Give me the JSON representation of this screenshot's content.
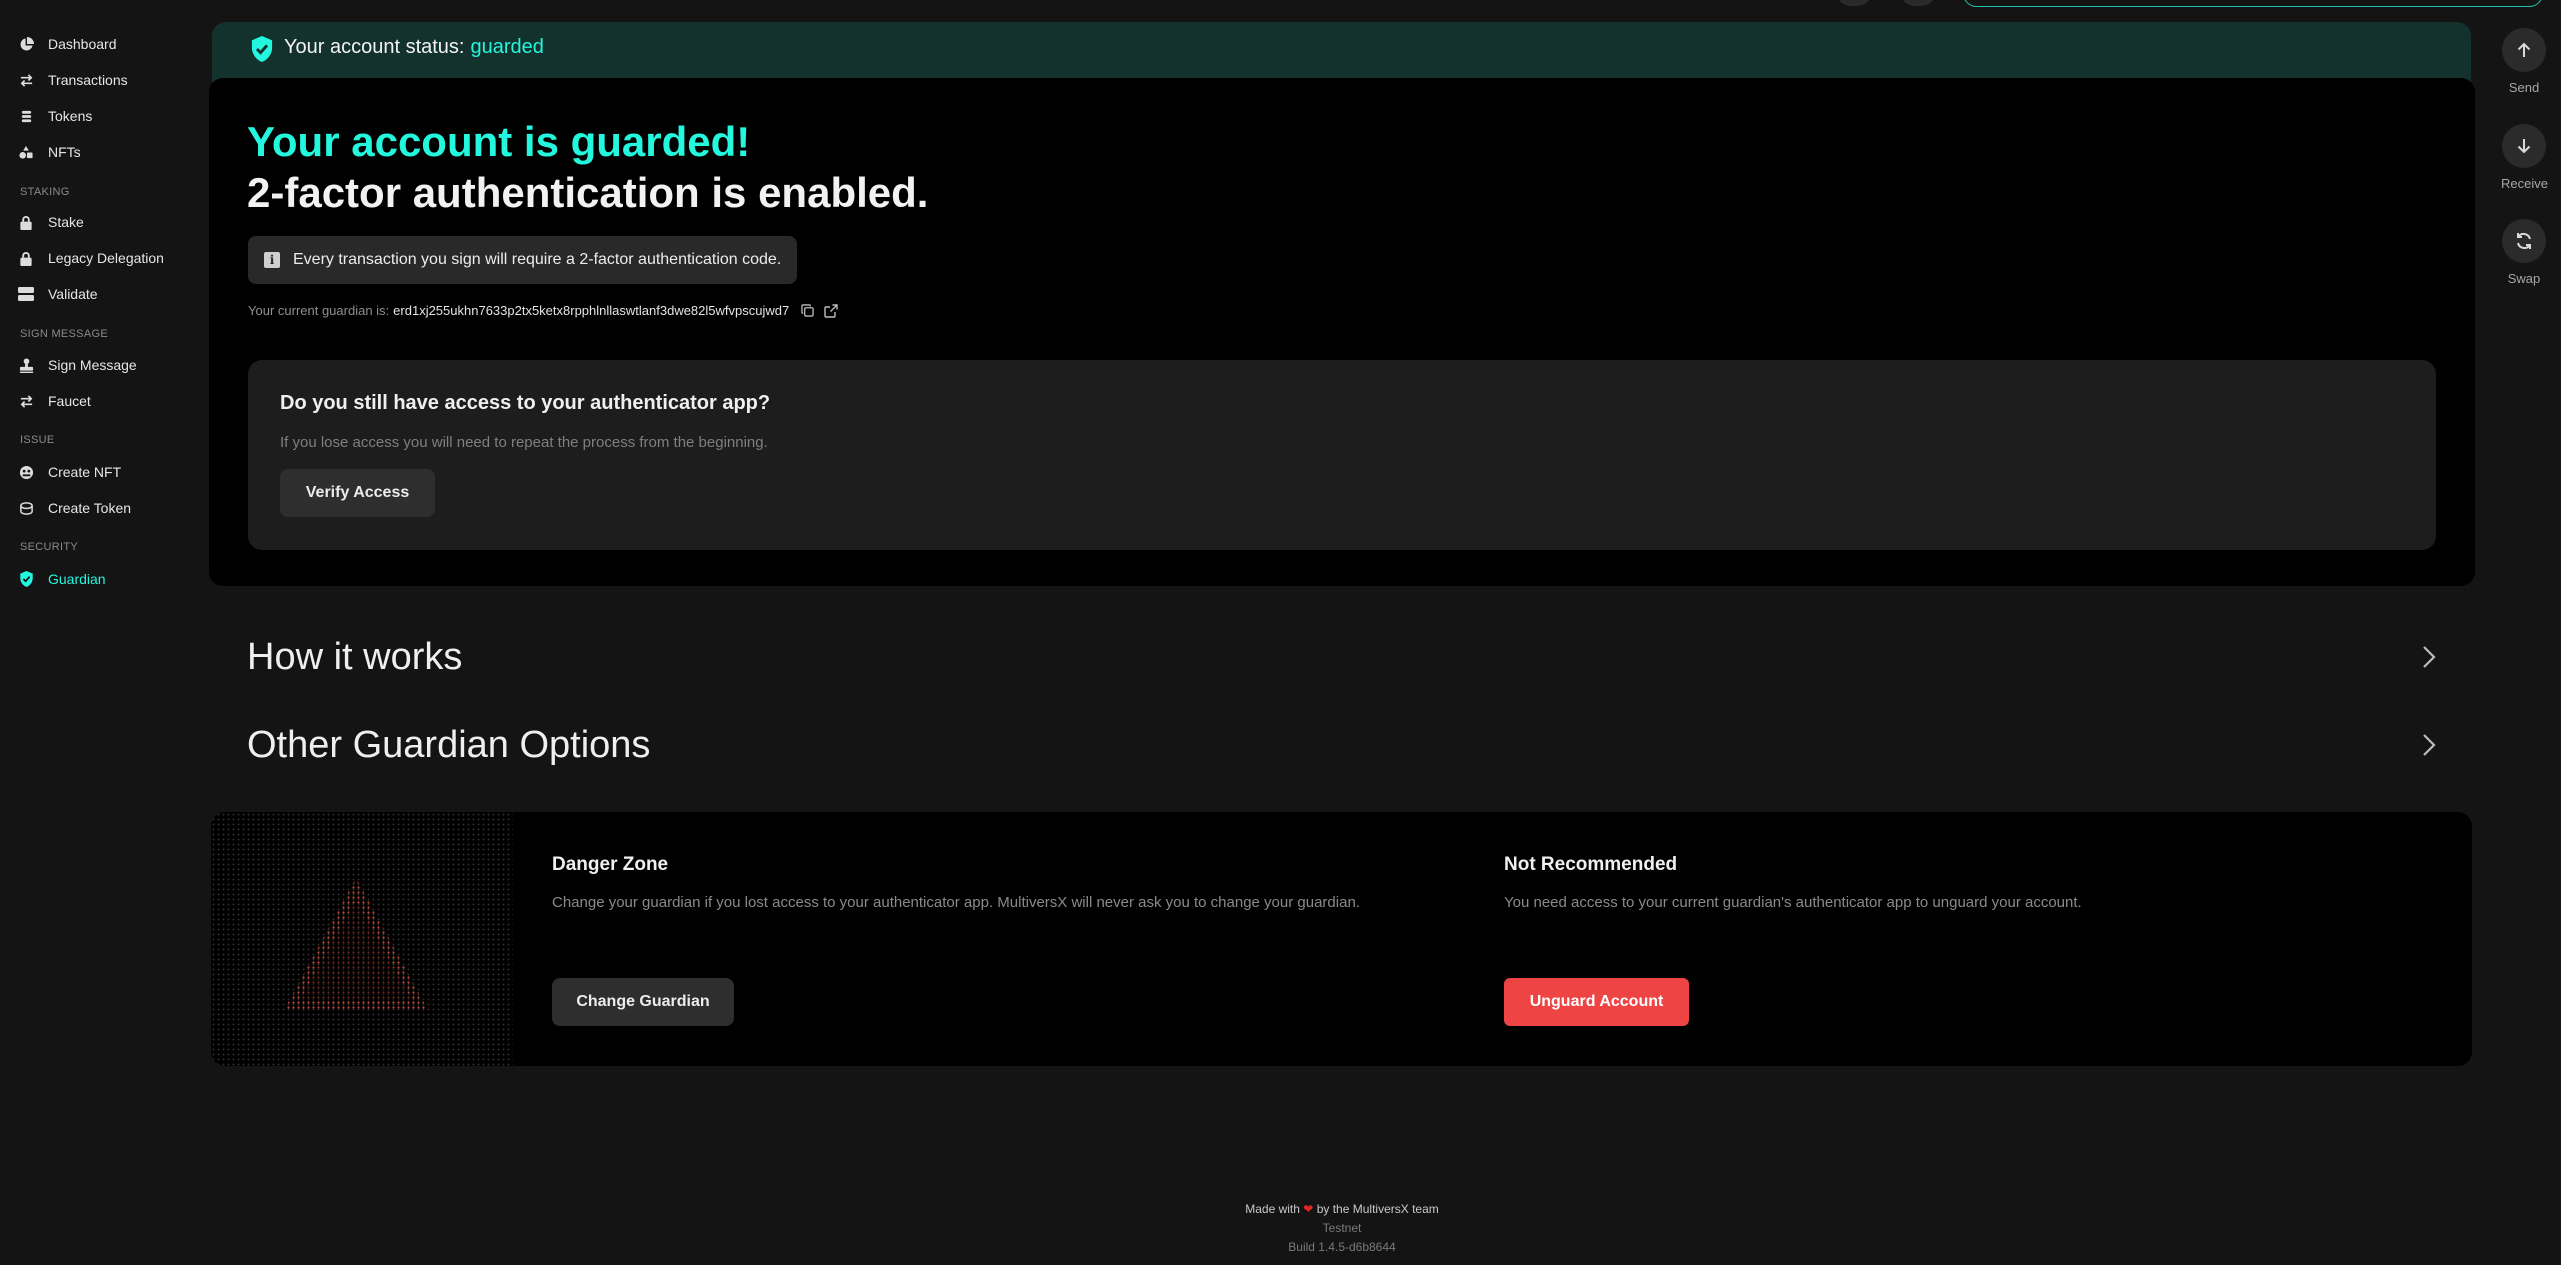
{
  "sidebar": {
    "items": [
      {
        "label": "Dashboard",
        "icon": "pie-chart-icon"
      },
      {
        "label": "Transactions",
        "icon": "arrows-exchange-icon"
      },
      {
        "label": "Tokens",
        "icon": "coins-icon"
      },
      {
        "label": "NFTs",
        "icon": "shapes-icon"
      }
    ],
    "sections": {
      "staking": "STAKING",
      "sign_message": "SIGN MESSAGE",
      "issue": "ISSUE",
      "security": "SECURITY"
    },
    "staking_items": [
      {
        "label": "Stake",
        "icon": "lock-icon"
      },
      {
        "label": "Legacy Delegation",
        "icon": "lock-icon"
      },
      {
        "label": "Validate",
        "icon": "server-icon"
      }
    ],
    "sign_items": [
      {
        "label": "Sign Message",
        "icon": "stamp-icon"
      },
      {
        "label": "Faucet",
        "icon": "arrows-exchange-icon"
      }
    ],
    "issue_items": [
      {
        "label": "Create NFT",
        "icon": "nft-icon"
      },
      {
        "label": "Create Token",
        "icon": "coins-icon"
      }
    ],
    "security_items": [
      {
        "label": "Guardian",
        "icon": "shield-check-icon",
        "active": true
      }
    ]
  },
  "actions": {
    "send": "Send",
    "receive": "Receive",
    "swap": "Swap"
  },
  "status": {
    "label": "Your account status:",
    "value": "guarded"
  },
  "main": {
    "heading_guarded": "Your account is guarded!",
    "heading_enabled": "2-factor authentication is enabled.",
    "info": "Every transaction you sign will require a 2-factor authentication code.",
    "guardian_label": "Your current guardian is:",
    "guardian_address": "erd1xj255ukhn7633p2tx5ketx8rpphlnllaswtlanf3dwe82l5wfvpscujwd7",
    "access_title": "Do you still have access to your authenticator app?",
    "access_sub": "If you lose access you will need to repeat the process from the beginning.",
    "verify_button": "Verify Access"
  },
  "accordions": {
    "how_it_works": "How it works",
    "other_options": "Other Guardian Options"
  },
  "danger": {
    "zone_title": "Danger Zone",
    "zone_desc": "Change your guardian if you lost access to your authenticator app. MultiversX will never ask you to change your guardian.",
    "change_button": "Change Guardian",
    "notrec_title": "Not Recommended",
    "notrec_desc": "You need access to your current guardian's authenticator app to unguard your account.",
    "unguard_button": "Unguard Account"
  },
  "footer": {
    "made_prefix": "Made with",
    "made_suffix": "by the MultiversX team",
    "network": "Testnet",
    "build": "Build 1.4.5-d6b8644"
  },
  "colors": {
    "accent": "#23f7dd",
    "danger": "#ef4444",
    "panel": "#000000",
    "background": "#141414"
  }
}
